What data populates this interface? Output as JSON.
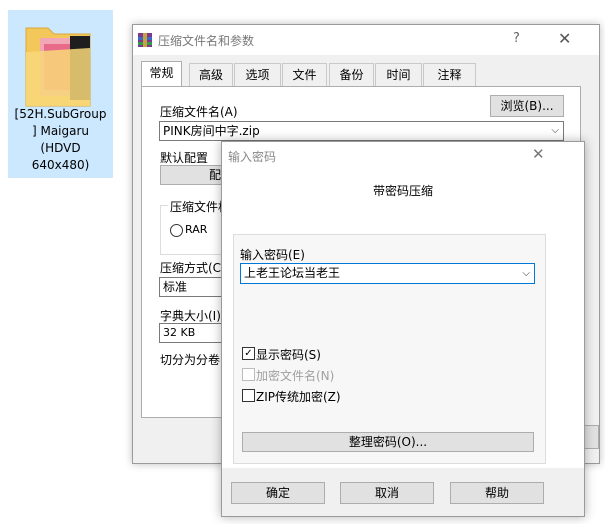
{
  "desktop": {
    "file_label_lines": [
      "[52H.SubGroup",
      "] Maigaru",
      "(HDVD",
      "640x480)"
    ]
  },
  "main_window": {
    "title": "压缩文件名和参数",
    "help_glyph": "?",
    "close_glyph": "✕",
    "tabs": [
      "常规",
      "高级",
      "选项",
      "文件",
      "备份",
      "时间",
      "注释"
    ],
    "archive_name_label": "压缩文件名(A)",
    "browse_button": "浏览(B)...",
    "archive_name_value": "PINK房间中字.zip",
    "default_profile_label": "默认配置",
    "profiles_button_partial": "配",
    "format_group_label": "压缩文件格",
    "format_rar": "RAR",
    "method_label": "压缩方式(C)",
    "method_value": "标准",
    "dict_label": "字典大小(I)",
    "dict_value": "32 KB",
    "split_label": "切分为分卷("
  },
  "password_dialog": {
    "title": "输入密码",
    "close_glyph": "✕",
    "heading": "带密码压缩",
    "password_label": "输入密码(E)",
    "password_value": "上老王论坛当老王",
    "show_password": {
      "label": "显示密码(S)",
      "checked": true
    },
    "encrypt_names": {
      "label": "加密文件名(N)",
      "checked": false,
      "disabled": true
    },
    "zip_legacy": {
      "label": "ZIP传统加密(Z)",
      "checked": false
    },
    "organize_button": "整理密码(O)...",
    "ok_button": "确定",
    "cancel_button": "取消",
    "help_button": "帮助"
  }
}
